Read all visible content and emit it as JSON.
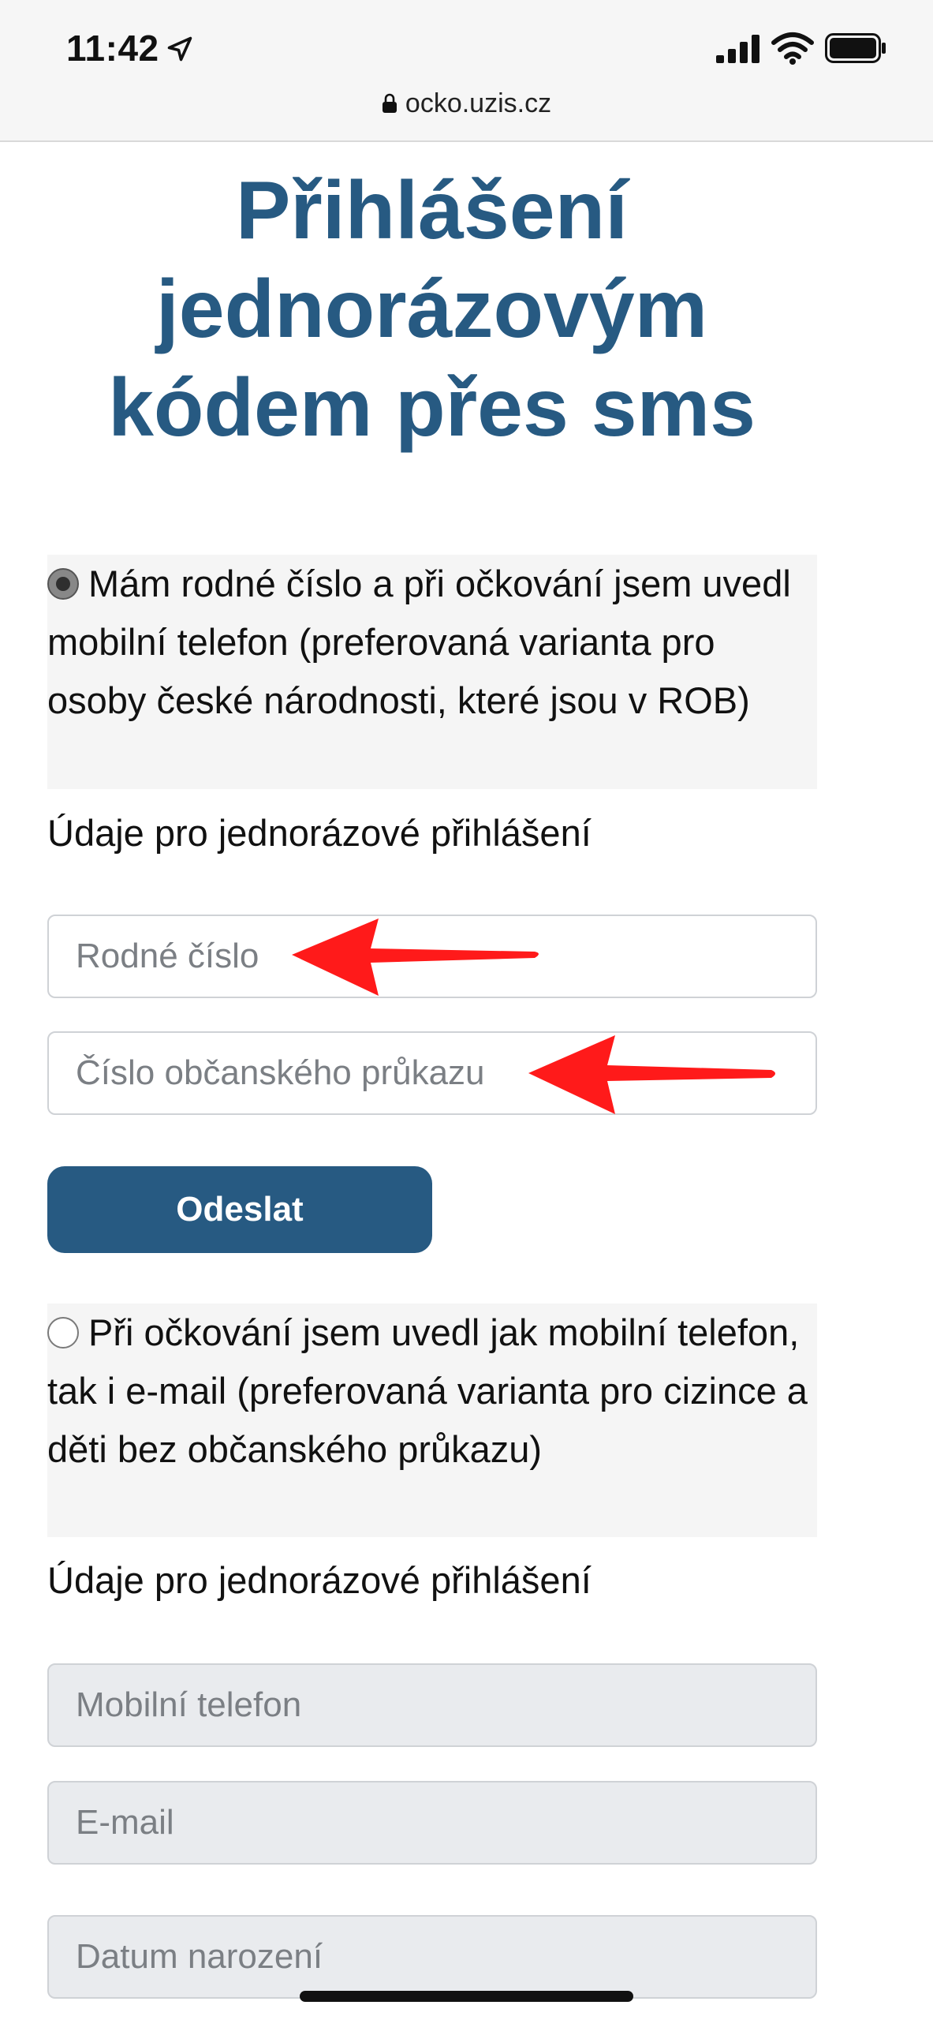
{
  "status_bar": {
    "time": "11:42"
  },
  "browser": {
    "url": "ocko.uzis.cz"
  },
  "page": {
    "title_lines": [
      "Přihlášení",
      "jednorázovým",
      "kódem přes sms"
    ]
  },
  "option_rc": {
    "label": "Mám rodné číslo a při očkování jsem uvedl mobilní telefon (preferovaná varianta pro osoby české národnosti, které jsou v ROB)",
    "selected": true,
    "section_label": "Údaje pro jednorázové přihlášení",
    "fields": {
      "rodne_cislo_placeholder": "Rodné číslo",
      "op_placeholder": "Číslo občanského průkazu"
    },
    "submit_label": "Odeslat"
  },
  "option_email": {
    "label": "Při očkování jsem uvedl jak mobilní telefon, tak i e-mail (preferovaná varianta pro cizince a děti bez občanského průkazu)",
    "selected": false,
    "section_label": "Údaje pro jednorázové přihlášení",
    "fields": {
      "phone_placeholder": "Mobilní telefon",
      "email_placeholder": "E-mail",
      "dob_placeholder": "Datum narození"
    }
  },
  "colors": {
    "brand": "#275a82",
    "annotation_arrow": "#ff1a1a"
  },
  "icons": [
    "location-arrow-icon",
    "signal-icon",
    "wifi-icon",
    "battery-icon",
    "lock-icon",
    "radio-checked-icon",
    "radio-unchecked-icon",
    "red-arrow-annotation"
  ]
}
